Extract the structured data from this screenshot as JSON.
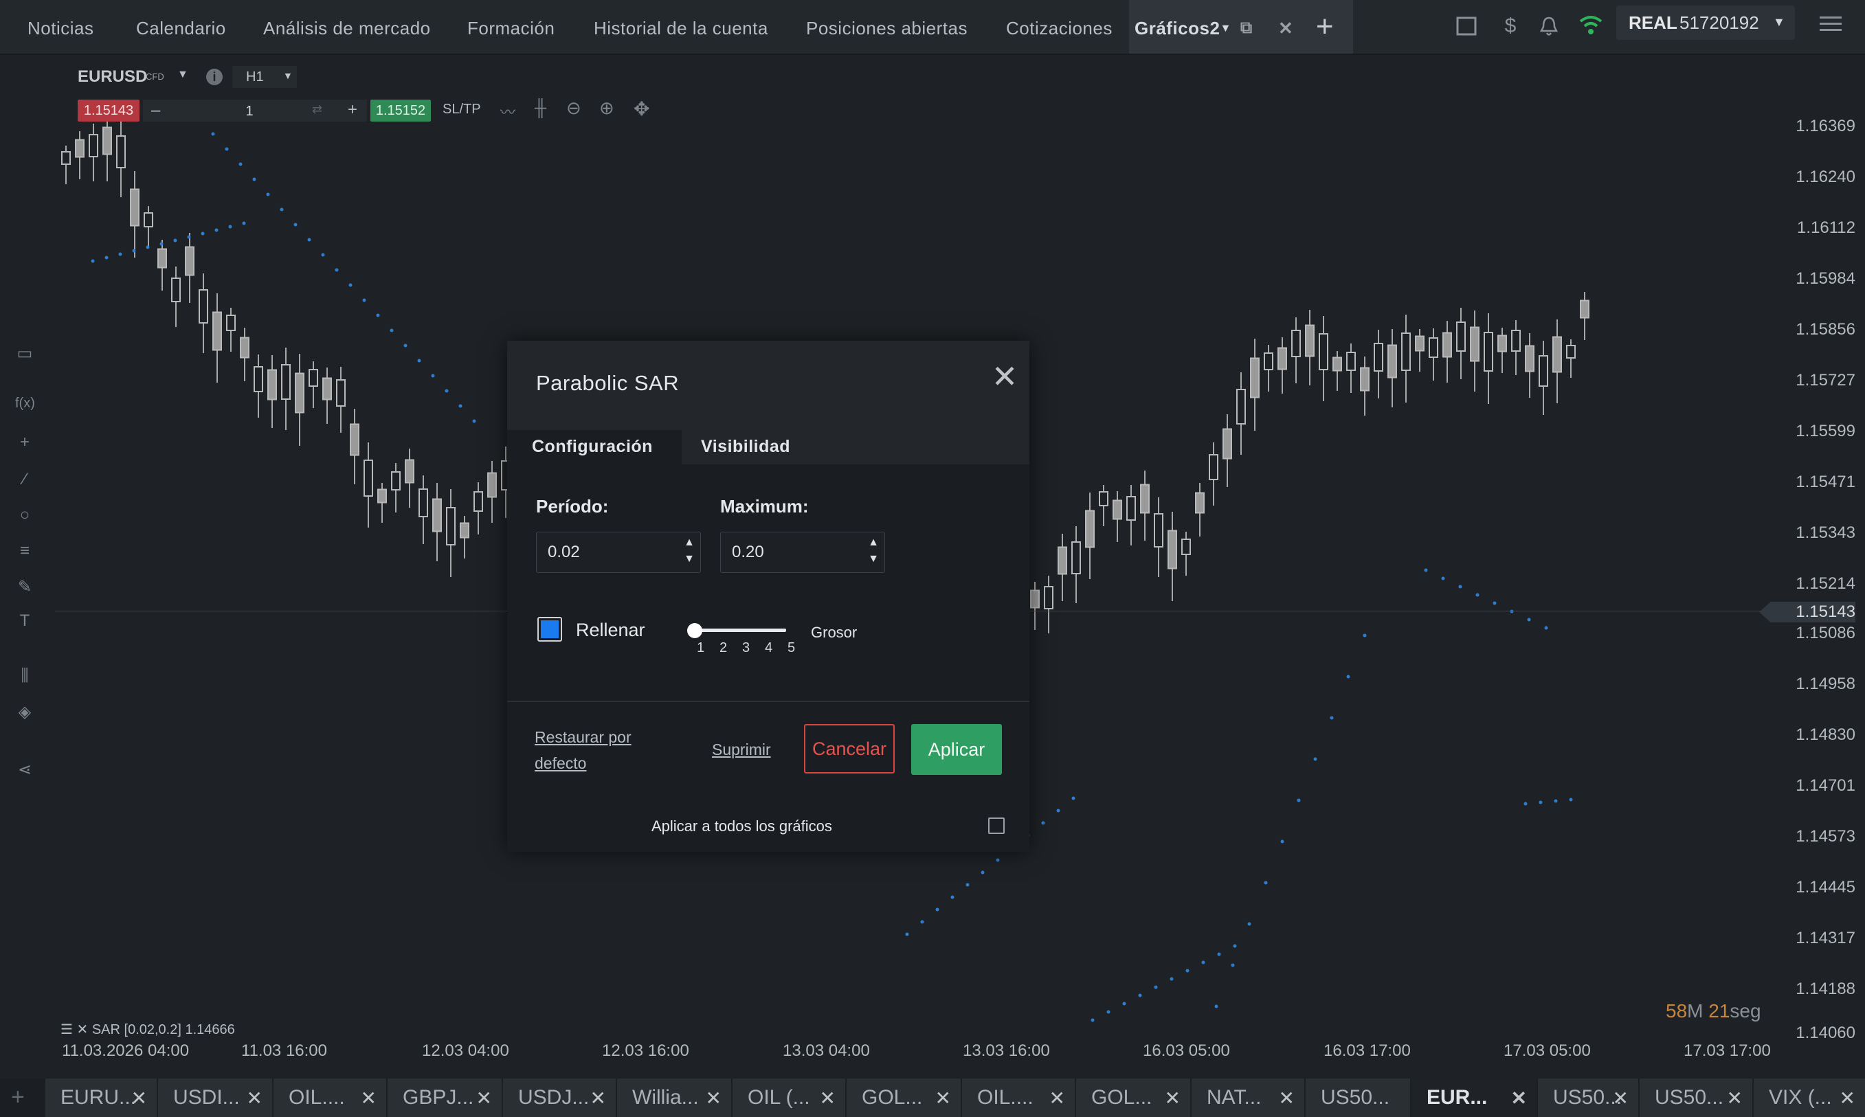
{
  "nav": {
    "items": [
      "Noticias",
      "Calendario",
      "Análisis de mercado",
      "Formación",
      "Historial de la cuenta",
      "Posiciones abiertas",
      "Cotizaciones"
    ],
    "active_tab": "Gráficos2",
    "account_type": "REAL",
    "account_number": "51720192"
  },
  "chart_toolbar": {
    "symbol": "EURUSD",
    "symbol_type": "CFD",
    "timeframe": "H1",
    "sell_price": "1.15143",
    "volume": "1",
    "buy_price": "1.15152",
    "sltp": "SL/TP"
  },
  "price_axis": [
    "1.16369",
    "1.16240",
    "1.16112",
    "1.15984",
    "1.15856",
    "1.15727",
    "1.15599",
    "1.15471",
    "1.15343",
    "1.15214",
    "1.15086",
    "1.14958",
    "1.14830",
    "1.14701",
    "1.14573",
    "1.14445",
    "1.14317",
    "1.14188",
    "1.14060"
  ],
  "current_price": "1.15143",
  "time_axis": [
    "11.03.2026 04:00",
    "11.03 16:00",
    "12.03 04:00",
    "12.03 16:00",
    "13.03 04:00",
    "13.03 16:00",
    "16.03 05:00",
    "16.03 17:00",
    "17.03 05:00",
    "17.03 17:00"
  ],
  "indicator_label": "SAR [0.02,0.2] 1.14666",
  "countdown": {
    "minutes": "58",
    "m_unit": "M",
    "seconds": "21",
    "s_unit": "seg"
  },
  "dialog": {
    "title": "Parabolic SAR",
    "tabs": [
      "Configuración",
      "Visibilidad"
    ],
    "period_label": "Período:",
    "period_value": "0.02",
    "maximum_label": "Maximum:",
    "maximum_value": "0.20",
    "fill_label": "Rellenar",
    "fill_color": "#1a7bf0",
    "thickness_label": "Grosor",
    "thickness_ticks": [
      "1",
      "2",
      "3",
      "4",
      "5"
    ],
    "thickness_value": 1,
    "restore_line1": "Restaurar por",
    "restore_line2": "defecto",
    "delete_label": "Suprimir",
    "cancel_label": "Cancelar",
    "apply_label": "Aplicar",
    "apply_all_label": "Aplicar a todos los gráficos"
  },
  "bottom_tabs": [
    "EURU...",
    "USDI...",
    "OIL....",
    "GBPJ...",
    "USDJ...",
    "Willia...",
    "OIL (...",
    "GOL...",
    "OIL....",
    "GOL...",
    "NAT...",
    "US50...",
    "EUR...",
    "US50...",
    "US50...",
    "VIX (..."
  ],
  "bottom_tab_active": "EUR...",
  "colors": {
    "bull": "#c8c8c8",
    "bear": "#9a9a9a",
    "sar": "#2f7fd0",
    "sell": "#b4383f",
    "buy": "#2f8a55",
    "apply": "#2f9e62",
    "cancel_border": "#d9443f"
  }
}
